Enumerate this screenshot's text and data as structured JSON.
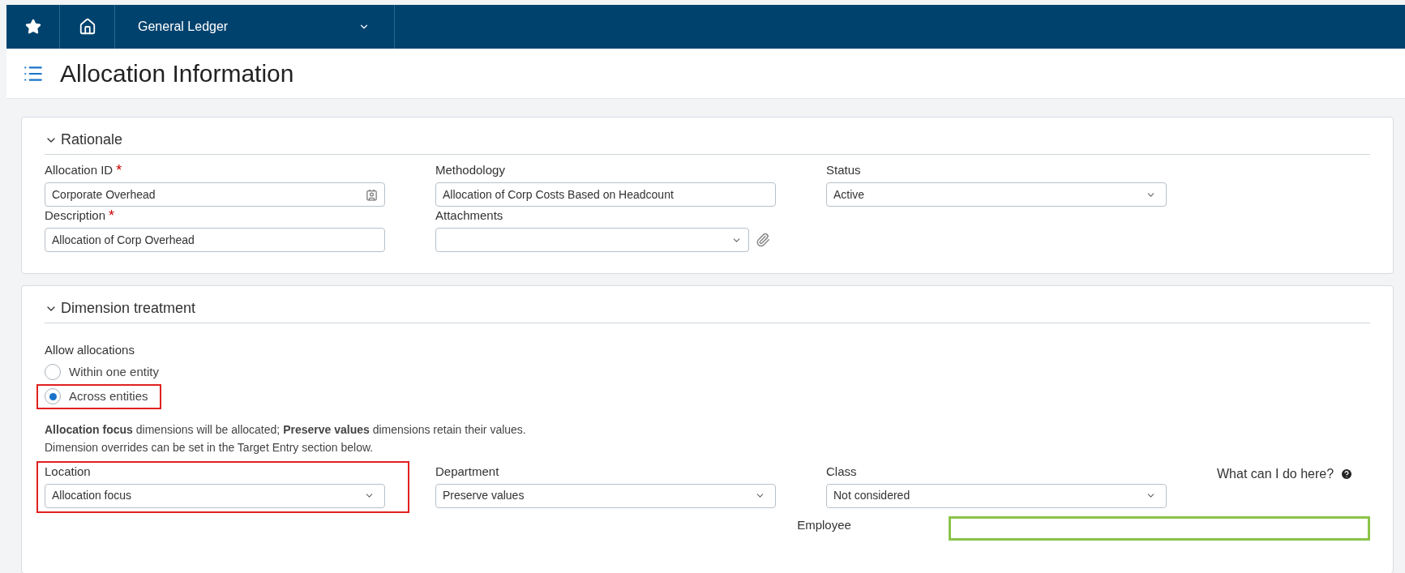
{
  "top_bar": {
    "module": "General Ledger"
  },
  "page": {
    "title": "Allocation Information"
  },
  "rationale": {
    "title": "Rationale",
    "expanded": true,
    "fields": [
      {
        "label": "Allocation ID",
        "required_mark": "*",
        "kind": "text",
        "value": "Corporate Overhead",
        "lookup": true
      },
      {
        "label": "Methodology",
        "kind": "text",
        "value": "Allocation of Corp Costs Based on Headcount",
        "lookup": false
      },
      {
        "label": "Status",
        "kind": "select",
        "value": "Active"
      },
      {
        "label": "Description",
        "required_mark": "*",
        "kind": "text",
        "value": "Allocation of Corp Overhead",
        "lookup": false
      },
      {
        "label": "Attachments",
        "kind": "attach"
      }
    ]
  },
  "dimension": {
    "title": "Dimension treatment",
    "expanded": true,
    "allow_label": "Allow allocations",
    "options": [
      {
        "label": "Within one entity",
        "selected": false,
        "highlighted": false
      },
      {
        "label": "Across entities",
        "selected": true,
        "highlighted": true
      }
    ],
    "note": "**Allocation focus** dimensions will be allocated; **Preserve values** dimensions retain their values.",
    "note2": "Dimension overrides can be set in the Target Entry section below.",
    "help": "What can I do here?",
    "fields": [
      {
        "label": "Location",
        "value": "Allocation focus",
        "highlighted": true
      },
      {
        "label": "Department",
        "value": "Preserve values",
        "highlighted": false
      },
      {
        "label": "Class",
        "value": "Not considered",
        "highlighted": false
      }
    ],
    "next_label": "Employee"
  }
}
